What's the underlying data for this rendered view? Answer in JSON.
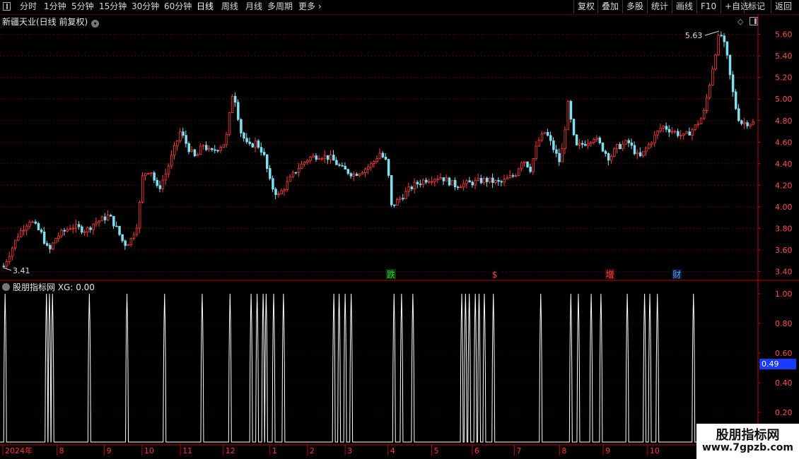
{
  "toolbar": {
    "left_items": [
      {
        "label": "分时",
        "x": 28
      },
      {
        "label": "1分钟",
        "x": 62
      },
      {
        "label": "5分钟",
        "x": 101
      },
      {
        "label": "15分钟",
        "x": 140
      },
      {
        "label": "30分钟",
        "x": 186
      },
      {
        "label": "60分钟",
        "x": 232
      },
      {
        "label": "日线",
        "x": 278,
        "active": true
      },
      {
        "label": "周线",
        "x": 313
      },
      {
        "label": "月线",
        "x": 347
      },
      {
        "label": "多周期",
        "x": 378
      },
      {
        "label": "更多",
        "x": 422
      }
    ],
    "more_chevron": "›",
    "right_items": [
      {
        "label": "复权",
        "x": 811
      },
      {
        "label": "叠加",
        "x": 845
      },
      {
        "label": "多股",
        "x": 880
      },
      {
        "label": "统计",
        "x": 915
      },
      {
        "label": "画线",
        "x": 950
      },
      {
        "label": "F10",
        "x": 985
      },
      {
        "label": "+自选",
        "x": 1019
      },
      {
        "label": "返回",
        "x": 1090
      }
    ],
    "extra_item": {
      "label": "标记",
      "x": 1052
    }
  },
  "chart": {
    "title": "新疆天业(日线 前复权)",
    "high_label": "5.63",
    "low_label": "3.41",
    "y_ticks": [
      "5.60",
      "5.40",
      "5.20",
      "5.00",
      "4.80",
      "4.60",
      "4.40",
      "4.20",
      "4.00",
      "3.80",
      "3.60",
      "3.40"
    ],
    "events": [
      {
        "label": "跌",
        "color": "#2ecc40",
        "bg": "#0a3a0a",
        "at": 0.515
      },
      {
        "label": "$",
        "color": "#ff4444",
        "bg": "#000000",
        "at": 0.655
      },
      {
        "label": "增",
        "color": "#ff4444",
        "bg": "#3a0a0a",
        "at": 0.806
      },
      {
        "label": "财",
        "color": "#5aa0ff",
        "bg": "#0a1a3a",
        "at": 0.895
      }
    ],
    "colors": {
      "up": "#ff3b3b",
      "down": "#7fe0f0",
      "grid": "#5a0000",
      "axis": "#c00000"
    }
  },
  "indicator": {
    "title": "股朋指标网 XG: 0.00",
    "y_ticks": [
      "1.00",
      "0.80",
      "0.60",
      "0.40",
      "0.20"
    ],
    "readout": "0.49",
    "line_color": "#ffffff"
  },
  "x_axis": {
    "labels": [
      {
        "label": "2024年",
        "at": 0.0
      },
      {
        "label": "8",
        "at": 0.072
      },
      {
        "label": "9",
        "at": 0.135
      },
      {
        "label": "10",
        "at": 0.185
      },
      {
        "label": "11",
        "at": 0.236
      },
      {
        "label": "12",
        "at": 0.293
      },
      {
        "label": "1",
        "at": 0.355
      },
      {
        "label": "2",
        "at": 0.405
      },
      {
        "label": "3",
        "at": 0.455
      },
      {
        "label": "4",
        "at": 0.512
      },
      {
        "label": "5",
        "at": 0.57
      },
      {
        "label": "6",
        "at": 0.624
      },
      {
        "label": "7",
        "at": 0.68
      },
      {
        "label": "8",
        "at": 0.74
      },
      {
        "label": "9",
        "at": 0.798
      },
      {
        "label": "10",
        "at": 0.857
      }
    ]
  },
  "chart_data": {
    "type": "candlestick",
    "ylim": [
      3.35,
      5.67
    ],
    "price_path": [
      [
        0,
        3.45
      ],
      [
        0.01,
        3.6
      ],
      [
        0.02,
        3.75
      ],
      [
        0.035,
        3.88
      ],
      [
        0.05,
        3.75
      ],
      [
        0.06,
        3.58
      ],
      [
        0.07,
        3.72
      ],
      [
        0.09,
        3.82
      ],
      [
        0.11,
        3.78
      ],
      [
        0.12,
        3.85
      ],
      [
        0.13,
        3.88
      ],
      [
        0.14,
        3.92
      ],
      [
        0.15,
        3.8
      ],
      [
        0.16,
        3.65
      ],
      [
        0.168,
        3.68
      ],
      [
        0.178,
        3.85
      ],
      [
        0.185,
        4.3
      ],
      [
        0.195,
        4.35
      ],
      [
        0.205,
        4.15
      ],
      [
        0.215,
        4.3
      ],
      [
        0.225,
        4.5
      ],
      [
        0.235,
        4.7
      ],
      [
        0.245,
        4.55
      ],
      [
        0.255,
        4.45
      ],
      [
        0.265,
        4.58
      ],
      [
        0.275,
        4.5
      ],
      [
        0.285,
        4.55
      ],
      [
        0.295,
        4.6
      ],
      [
        0.305,
        5.1
      ],
      [
        0.315,
        4.7
      ],
      [
        0.325,
        4.55
      ],
      [
        0.335,
        4.6
      ],
      [
        0.345,
        4.5
      ],
      [
        0.355,
        4.2
      ],
      [
        0.365,
        4.1
      ],
      [
        0.375,
        4.2
      ],
      [
        0.39,
        4.35
      ],
      [
        0.405,
        4.45
      ],
      [
        0.42,
        4.48
      ],
      [
        0.435,
        4.45
      ],
      [
        0.45,
        4.35
      ],
      [
        0.465,
        4.3
      ],
      [
        0.48,
        4.35
      ],
      [
        0.49,
        4.4
      ],
      [
        0.5,
        4.5
      ],
      [
        0.51,
        4.4
      ],
      [
        0.515,
        4.0
      ],
      [
        0.53,
        4.1
      ],
      [
        0.545,
        4.2
      ],
      [
        0.56,
        4.25
      ],
      [
        0.58,
        4.28
      ],
      [
        0.6,
        4.2
      ],
      [
        0.62,
        4.22
      ],
      [
        0.64,
        4.25
      ],
      [
        0.66,
        4.22
      ],
      [
        0.68,
        4.3
      ],
      [
        0.69,
        4.45
      ],
      [
        0.7,
        4.35
      ],
      [
        0.71,
        4.6
      ],
      [
        0.72,
        4.7
      ],
      [
        0.73,
        4.55
      ],
      [
        0.74,
        4.4
      ],
      [
        0.75,
        4.95
      ],
      [
        0.76,
        4.55
      ],
      [
        0.775,
        4.6
      ],
      [
        0.785,
        4.65
      ],
      [
        0.795,
        4.55
      ],
      [
        0.805,
        4.45
      ],
      [
        0.815,
        4.55
      ],
      [
        0.83,
        4.6
      ],
      [
        0.845,
        4.45
      ],
      [
        0.86,
        4.6
      ],
      [
        0.875,
        4.75
      ],
      [
        0.89,
        4.7
      ],
      [
        0.905,
        4.65
      ],
      [
        0.92,
        4.75
      ],
      [
        0.93,
        4.85
      ],
      [
        0.94,
        5.2
      ],
      [
        0.945,
        5.4
      ],
      [
        0.952,
        5.63
      ],
      [
        0.96,
        5.45
      ],
      [
        0.968,
        5.1
      ],
      [
        0.975,
        4.85
      ],
      [
        0.98,
        4.78
      ]
    ],
    "xg_spikes": [
      0.003,
      0.058,
      0.062,
      0.066,
      0.115,
      0.165,
      0.215,
      0.265,
      0.302,
      0.33,
      0.338,
      0.346,
      0.35,
      0.36,
      0.373,
      0.44,
      0.447,
      0.455,
      0.463,
      0.52,
      0.53,
      0.545,
      0.61,
      0.615,
      0.62,
      0.628,
      0.633,
      0.64,
      0.652,
      0.715,
      0.755,
      0.765,
      0.782,
      0.795,
      0.83,
      0.853,
      0.86,
      0.87,
      0.918
    ],
    "xg_levels": [
      "0.00",
      "1.00"
    ]
  }
}
